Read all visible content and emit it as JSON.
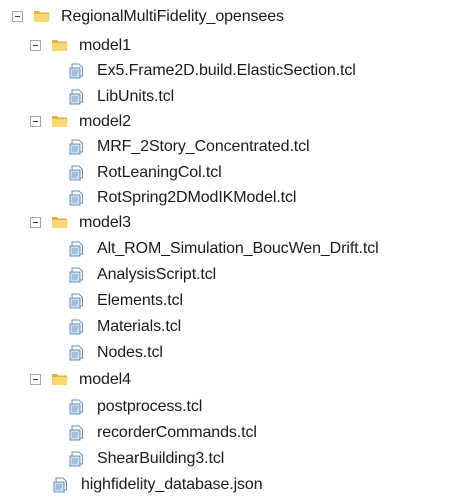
{
  "tree": {
    "root": {
      "label": "RegionalMultiFidelity_opensees",
      "expanded": true
    },
    "folders": [
      {
        "label": "model1",
        "expanded": true,
        "files": [
          "Ex5.Frame2D.build.ElasticSection.tcl",
          "LibUnits.tcl"
        ]
      },
      {
        "label": "model2",
        "expanded": true,
        "files": [
          "MRF_2Story_Concentrated.tcl",
          "RotLeaningCol.tcl",
          "RotSpring2DModIKModel.tcl"
        ]
      },
      {
        "label": "model3",
        "expanded": true,
        "files": [
          "Alt_ROM_Simulation_BoucWen_Drift.tcl",
          "AnalysisScript.tcl",
          "Elements.tcl",
          "Materials.tcl",
          "Nodes.tcl"
        ]
      },
      {
        "label": "model4",
        "expanded": true,
        "files": [
          "postprocess.tcl",
          "recorderCommands.tcl",
          "ShearBuilding3.tcl"
        ]
      }
    ],
    "root_files": [
      "highfidelity_database.json"
    ]
  },
  "icons": {
    "expander": "collapse-toggle-icon",
    "folder": "folder-icon",
    "file": "document-file-icon"
  },
  "colors": {
    "folder_body": "#f8d775",
    "folder_back": "#e2b33f",
    "file_page": "#ffffff",
    "file_shade": "#c9dff2",
    "file_outline": "#6d8fb5",
    "toggle_border": "#a6a6a6",
    "text": "#1a1a1a"
  }
}
